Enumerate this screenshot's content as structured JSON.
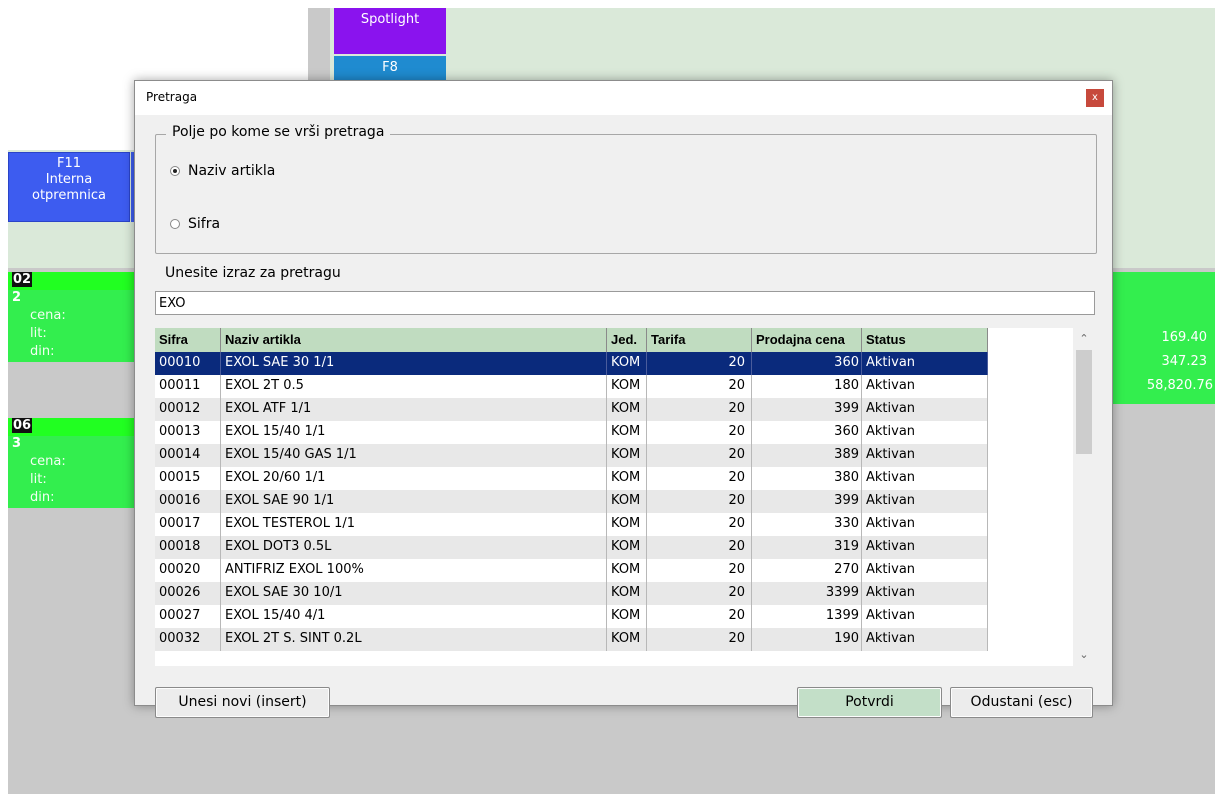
{
  "background": {
    "spotlight_label": "Spotlight",
    "f8_label": "F8",
    "f11": {
      "key": "F11",
      "line1": "Interna",
      "line2": "otpremnica"
    },
    "stations": [
      {
        "id": "02",
        "number": "2",
        "labels": [
          "cena:",
          "lit:",
          "din:"
        ],
        "values": [
          "169.40",
          "347.23",
          "58,820.76"
        ]
      },
      {
        "id": "06",
        "number": "3",
        "labels": [
          "cena:",
          "lit:",
          "din:"
        ]
      }
    ]
  },
  "dialog": {
    "title": "Pretraga",
    "close_glyph": "x",
    "group_legend": "Polje po kome se vrši pretraga",
    "radio_options": [
      {
        "label": "Naziv artikla",
        "checked": true
      },
      {
        "label": "Sifra",
        "checked": false
      }
    ],
    "search_label": "Unesite izraz za pretragu",
    "search_value": "EXO",
    "columns": [
      "Sifra",
      "Naziv artikla",
      "Jed.",
      "Tarifa",
      "Prodajna cena",
      "Status"
    ],
    "rows": [
      [
        "00010",
        "EXOL SAE 30 1/1",
        "KOM",
        "20",
        "360",
        "Aktivan"
      ],
      [
        "00011",
        "EXOL 2T 0.5",
        "KOM",
        "20",
        "180",
        "Aktivan"
      ],
      [
        "00012",
        "EXOL ATF 1/1",
        "KOM",
        "20",
        "399",
        "Aktivan"
      ],
      [
        "00013",
        "EXOL 15/40 1/1",
        "KOM",
        "20",
        "360",
        "Aktivan"
      ],
      [
        "00014",
        "EXOL 15/40 GAS 1/1",
        "KOM",
        "20",
        "389",
        "Aktivan"
      ],
      [
        "00015",
        "EXOL 20/60 1/1",
        "KOM",
        "20",
        "380",
        "Aktivan"
      ],
      [
        "00016",
        "EXOL SAE 90 1/1",
        "KOM",
        "20",
        "399",
        "Aktivan"
      ],
      [
        "00017",
        "EXOL TESTEROL 1/1",
        "KOM",
        "20",
        "330",
        "Aktivan"
      ],
      [
        "00018",
        "EXOL DOT3 0.5L",
        "KOM",
        "20",
        "319",
        "Aktivan"
      ],
      [
        "00020",
        "ANTIFRIZ EXOL 100%",
        "KOM",
        "20",
        "270",
        "Aktivan"
      ],
      [
        "00026",
        "EXOL SAE 30 10/1",
        "KOM",
        "20",
        "3399",
        "Aktivan"
      ],
      [
        "00027",
        "EXOL 15/40  4/1",
        "KOM",
        "20",
        "1399",
        "Aktivan"
      ],
      [
        "00032",
        "EXOL 2T S. SINT 0.2L",
        "KOM",
        "20",
        "190",
        "Aktivan"
      ]
    ],
    "selected_row": 0,
    "buttons": {
      "new_label": "Unesi novi (insert)",
      "confirm_label": "Potvrdi",
      "cancel_label": "Odustani (esc)"
    }
  }
}
